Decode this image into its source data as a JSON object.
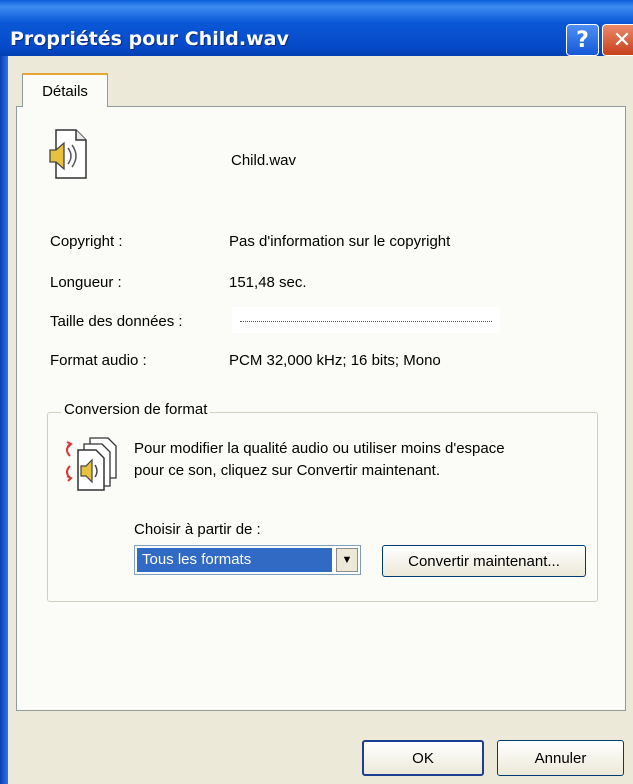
{
  "window": {
    "title": "Propriétés pour Child.wav"
  },
  "titlebar": {
    "help_glyph": "?",
    "close_glyph": "✕",
    "help_icon": "help-icon",
    "close_icon": "close-icon"
  },
  "tabs": [
    {
      "label": "Détails",
      "selected": true
    }
  ],
  "file": {
    "name": "Child.wav",
    "icon": "sound-file-icon"
  },
  "properties": {
    "copyright_label": "Copyright :",
    "copyright_value": "Pas d'information sur le copyright",
    "length_label": "Longueur :",
    "length_value": "151,48 sec.",
    "data_size_label": "Taille des données :",
    "audio_format_label": "Format audio :",
    "audio_format_value": "PCM 32,000 kHz; 16 bits; Mono"
  },
  "conversion": {
    "group_title": "Conversion de format",
    "description_line1": "Pour modifier la qualité audio ou utiliser moins d'espace",
    "description_line2": "pour ce son, cliquez sur Convertir maintenant.",
    "choose_label": "Choisir à partir de :",
    "format_selected": "Tous les formats",
    "convert_button": "Convertir maintenant...",
    "icon": "convert-sound-icon"
  },
  "buttons": {
    "ok": "OK",
    "cancel": "Annuler"
  },
  "colors": {
    "title_bar": "#0a58d6",
    "selection": "#316ac5",
    "dialog_bg": "#ece9d8"
  }
}
